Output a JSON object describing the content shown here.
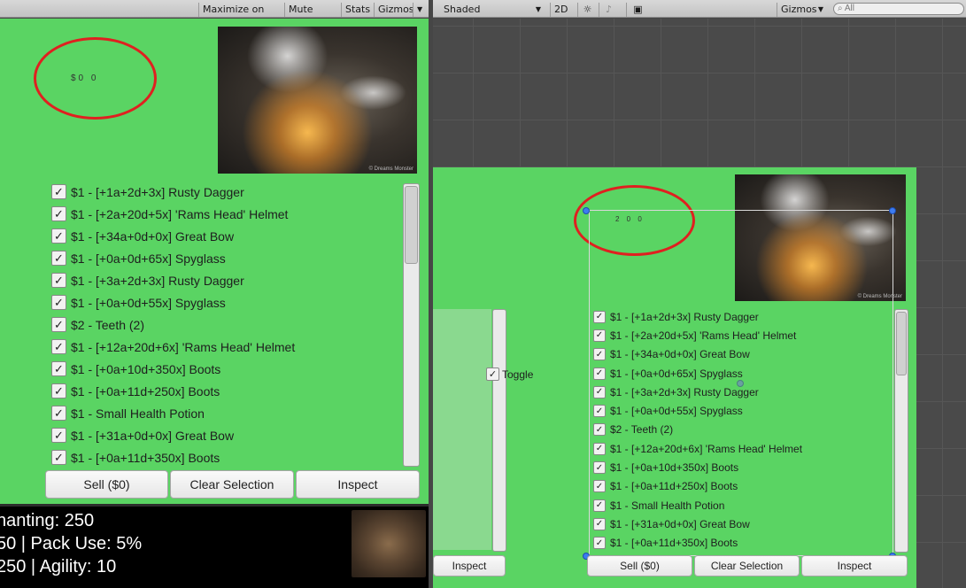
{
  "game_toolbar": {
    "maximize_on_play": "Maximize on Play",
    "mute_audio": "Mute audio",
    "stats": "Stats",
    "gizmos": "Gizmos"
  },
  "scene_toolbar": {
    "shading_mode": "Shaded",
    "mode_2d": "2D",
    "gizmos": "Gizmos",
    "search_placeholder": "All"
  },
  "game": {
    "gold_label_partial": "$0  0",
    "art_caption": "© Dreams Monster",
    "items": [
      "$1 - [+1a+2d+3x] Rusty Dagger",
      "$1 - [+2a+20d+5x] 'Rams Head' Helmet",
      "$1 - [+34a+0d+0x] Great Bow",
      "$1 - [+0a+0d+65x] Spyglass",
      "$1 - [+3a+2d+3x] Rusty Dagger",
      "$1 - [+0a+0d+55x] Spyglass",
      "$2 - Teeth (2)",
      "$1 - [+12a+20d+6x] 'Rams Head' Helmet",
      "$1 - [+0a+10d+350x] Boots",
      "$1 - [+0a+11d+250x] Boots",
      "$1 - Small Health Potion",
      "$1 - [+31a+0d+0x] Great Bow",
      "$1 - [+0a+11d+350x] Boots"
    ],
    "sell_button": "Sell ($0)",
    "clear_button": "Clear Selection",
    "inspect_button": "Inspect",
    "stats_lines": [
      "hanting: 250",
      "50  |  Pack Use: 5%",
      "250  |  Agility: 10"
    ]
  },
  "scene": {
    "toggle_label": "Toggle",
    "left_inspect_button": "Inspect",
    "gold_label_partial": "2   0   0",
    "items": [
      "$1 - [+1a+2d+3x] Rusty Dagger",
      "$1 - [+2a+20d+5x] 'Rams Head' Helmet",
      "$1 - [+34a+0d+0x] Great Bow",
      "$1 - [+0a+0d+65x] Spyglass",
      "$1 - [+3a+2d+3x] Rusty Dagger",
      "$1 - [+0a+0d+55x] Spyglass",
      "$2 - Teeth (2)",
      "$1 - [+12a+20d+6x] 'Rams Head' Helmet",
      "$1 - [+0a+10d+350x] Boots",
      "$1 - [+0a+11d+250x] Boots",
      "$1 - Small Health Potion",
      "$1 - [+31a+0d+0x] Great Bow",
      "$1 - [+0a+11d+350x] Boots"
    ],
    "sell_button": "Sell ($0)",
    "clear_button": "Clear Selection",
    "inspect_button": "Inspect"
  },
  "colors": {
    "panel_green": "#5ad463",
    "highlight_circle": "#e02020",
    "handle_blue": "#3d7cf0"
  }
}
